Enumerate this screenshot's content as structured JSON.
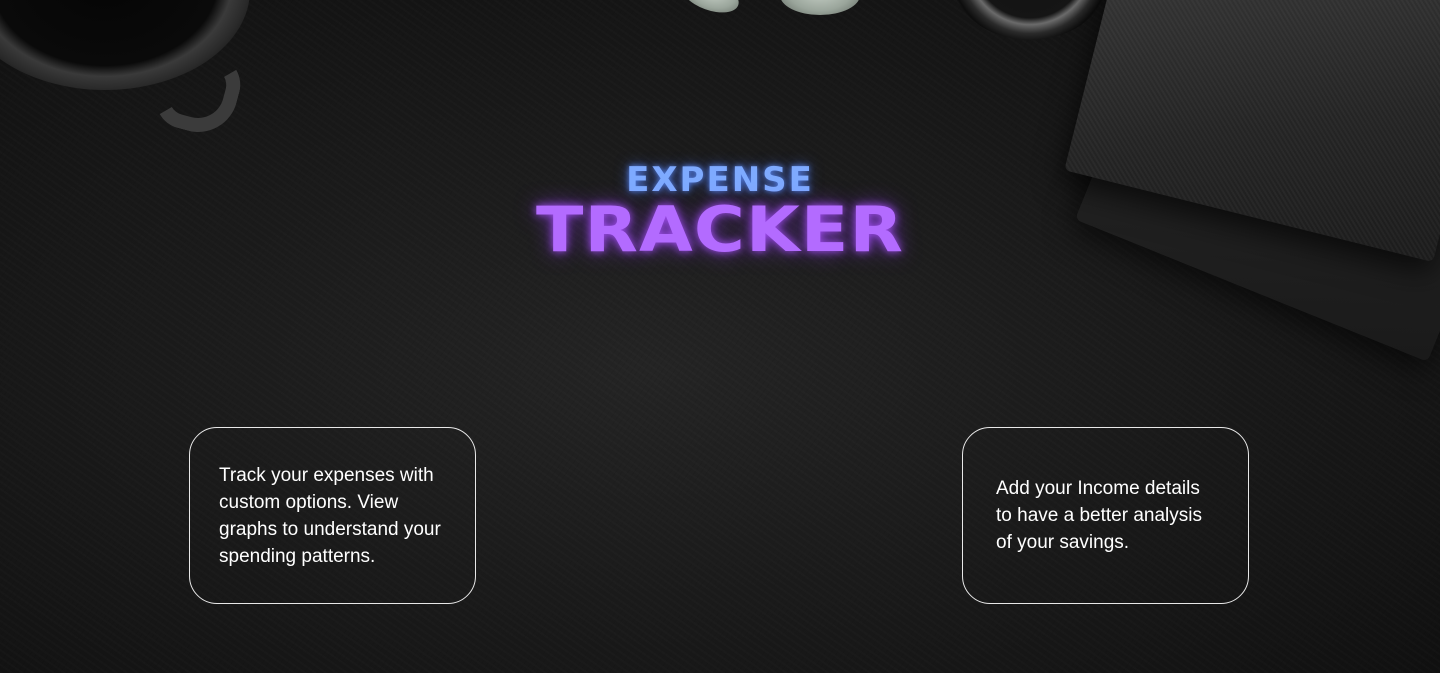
{
  "logo": {
    "top_text": "EXPENSE",
    "bottom_text": "TRACKER",
    "top_color": "#7eaaff",
    "bottom_color": "#b36bff"
  },
  "cards": [
    {
      "text": "Track your expenses with custom options. View graphs  to understand your spending patterns."
    },
    {
      "text": "Add your Income details to have a better analysis of your savings."
    }
  ],
  "background": {
    "color": "#161616",
    "decorations": [
      "coffee-mug-icon",
      "plant-icon",
      "camera-lens-icon",
      "notebook-icon"
    ]
  }
}
